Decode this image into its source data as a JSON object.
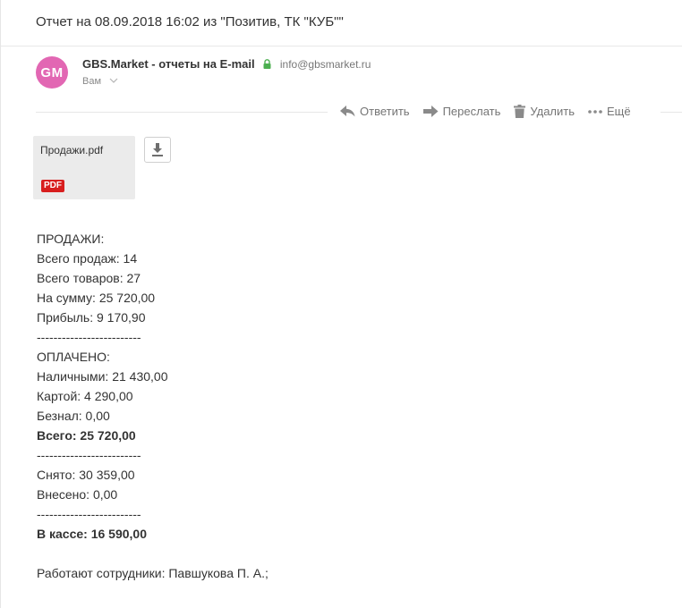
{
  "subject": "Отчет на 08.09.2018 16:02 из \"Позитив, ТК \"КУБ\"\"",
  "sender": {
    "avatar_initials": "GM",
    "avatar_color": "#e267b3",
    "name": "GBS.Market - отчеты на E-mail",
    "email": "info@gbsmarket.ru",
    "recipient": "Вам"
  },
  "actions": {
    "reply": "Ответить",
    "forward": "Переслать",
    "delete": "Удалить",
    "more": "Ещё"
  },
  "attachment": {
    "filename": "Продажи.pdf",
    "badge": "PDF",
    "badge_color": "#d81e1e"
  },
  "body": {
    "lines": [
      "ПРОДАЖИ:",
      "Всего продаж: 14",
      "Всего товаров: 27",
      "На сумму: 25 720,00",
      "Прибыль: 9 170,90",
      "-------------------------",
      "ОПЛАЧЕНО:",
      "Наличными: 21 430,00",
      "Картой: 4 290,00",
      "Безнал: 0,00",
      "Всего: 25 720,00",
      "-------------------------",
      "Снято: 30 359,00",
      "Внесено: 0,00",
      "-------------------------",
      "В кассе: 16 590,00"
    ],
    "staff": "Работают сотрудники: Павшукова П. А.;"
  }
}
